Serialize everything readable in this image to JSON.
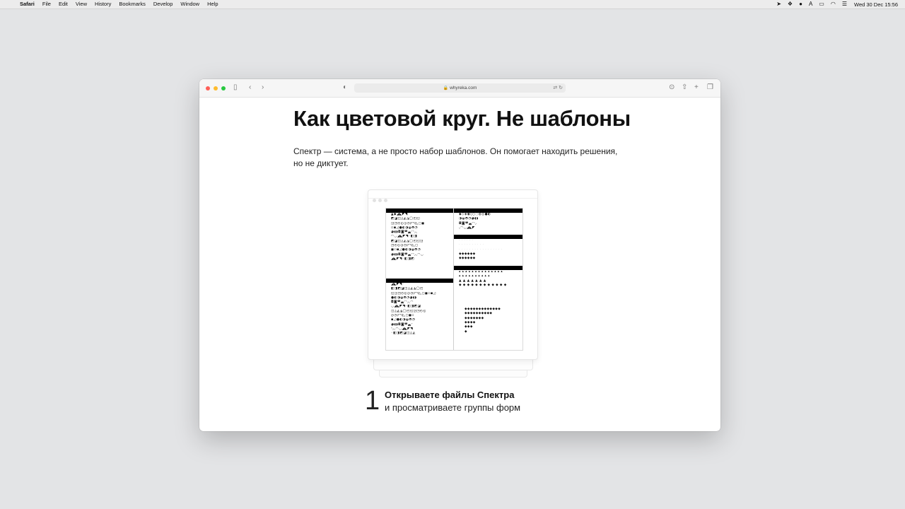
{
  "menubar": {
    "app": "Safari",
    "items": [
      "File",
      "Edit",
      "View",
      "History",
      "Bookmarks",
      "Develop",
      "Window",
      "Help"
    ],
    "status_icons": [
      "location-icon",
      "dropbox-icon",
      "notification-icon",
      "text-icon",
      "battery-icon",
      "wifi-icon",
      "control-center-icon"
    ],
    "clock": "Wed 30 Dec  15:56"
  },
  "browser": {
    "url": "whyreka.com",
    "traffic_lights": {
      "close": "#ff5f57",
      "minimize": "#febc2e",
      "zoom": "#28c840"
    }
  },
  "page": {
    "title": "Как цветовой круг. Не шаблоны",
    "lead_line1": "Спектр — система, а не просто набор шаблонов. Он помогает находить решения,",
    "lead_line2": "но не диктует.",
    "step": {
      "number": "1",
      "title": "Открываете файлы Спектра",
      "subtitle": "и просматриваете группы форм"
    }
  },
  "illustration": {
    "panels": [
      {
        "rows": [
          "▲◆◢◣◤◥",
          "◩◪◫◬◭◮◯◰◱",
          "◲◳◴◵◶◷◸◹◺◻◼",
          "◽◾◿●◐◑◒◓◔",
          "◕◖◗◘◙◚◛◜◝◞◟",
          "◠◡◢◣◤◥◦◧◨",
          "◩◪◫◬◭◮◯◰◱◲",
          "◳◴◵◶◷◸◹◺◻",
          "◼◽◾◿●◐◑◒◓◔",
          "◕◖◗◘◙◚◛◜◝◞◟◠◡",
          "◢◣◤◥◦◧◨◩"
        ]
      },
      {
        "rows": [
          "◆◇◈◉◊○◌◍◎●◐",
          "◑◒◓◔◕◖◗",
          "◘◙◚◛◜◝◞",
          "◟◠◡◢◣◤"
        ]
      },
      {
        "rows_light": [
          "· · · · · ·",
          "· · · · · · · · · ·",
          "· · · · · · · · · · · · · · · · ·"
        ],
        "rows": [
          "◆◆◆◆◆◆",
          "◆◆◆◆◆◆"
        ]
      },
      {
        "rows": [
          "▴ ▴ ▴ ▴ ▴ ▴ ▴ ▴ ▴ ▴ ▴ ▴ ▴ ▴",
          "▴ ▴ ▴ ▴ ▴ ▴ ▴ ▴ ▴ ▴",
          "▲ ▲ ▲ ▲ ▲ ▲ ▲",
          "◆ ◆ ◆ ◆ ◆ ◆ ◆ ◆ ◆ ◆ ◆ ◆"
        ],
        "rows_tail": [
          "◆◆◆◆◆◆◆◆◆◆◆◆◆",
          "◆◆◆◆◆◆◆◆◆◆",
          "◆◆◆◆◆◆◆",
          "◆◆◆◆",
          "◆◆◆",
          "◆"
        ]
      },
      {
        "rows": [
          "◢◣◤◥◦",
          "◧◨◩◪◫◬◭◮◯◰",
          "◱◲◳◴◵◶◷◸◹◺◻◼◽◾◿",
          "●◐◑◒◓◔◕◖◗",
          "◘◙◚◛◜◝◞◟◠",
          "◡◢◣◤◥◦◧◨◩◪",
          "◫◬◭◮◯◰◱◲◳◴◵",
          "◶◷◸◹◺◻◼◽",
          "◾◿●◐◑◒◓◔",
          "◕◖◗◘◙◚◛◜",
          "◝◞◟◠◡◢◣◤◥",
          "◦◧◨◩◪◫◬◭"
        ]
      }
    ]
  }
}
